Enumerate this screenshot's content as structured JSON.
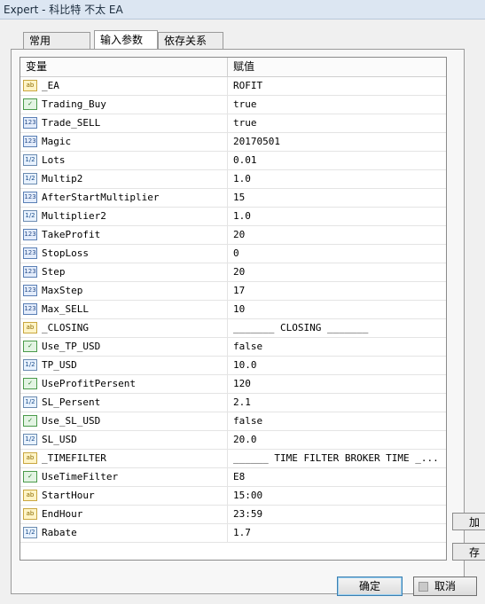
{
  "window": {
    "title": "Expert - 科比特 不太 EA"
  },
  "tabs": [
    {
      "label": "常用"
    },
    {
      "label": "输入参数"
    },
    {
      "label": "依存关系"
    }
  ],
  "grid": {
    "columns": {
      "variable": "变量",
      "value": "赋值"
    },
    "rows": [
      {
        "icon": "ab",
        "var": "_EA",
        "val": "ROFIT"
      },
      {
        "icon": "bool",
        "var": "Trading_Buy",
        "val": "true"
      },
      {
        "icon": "int",
        "var": "Trade_SELL",
        "val": "true"
      },
      {
        "icon": "int",
        "var": "Magic",
        "val": "20170501"
      },
      {
        "icon": "dbl",
        "var": "Lots",
        "val": "0.01"
      },
      {
        "icon": "dbl",
        "var": "Multip2",
        "val": "1.0"
      },
      {
        "icon": "int",
        "var": "AfterStartMultiplier",
        "val": "15"
      },
      {
        "icon": "dbl",
        "var": "Multiplier2",
        "val": "1.0"
      },
      {
        "icon": "int",
        "var": "TakeProfit",
        "val": "20"
      },
      {
        "icon": "int",
        "var": "StopLoss",
        "val": "0"
      },
      {
        "icon": "int",
        "var": "Step",
        "val": "20"
      },
      {
        "icon": "int",
        "var": "MaxStep",
        "val": "17"
      },
      {
        "icon": "int",
        "var": "Max_SELL",
        "val": "10"
      },
      {
        "icon": "ab",
        "var": "_CLOSING",
        "val": "_______ CLOSING _______"
      },
      {
        "icon": "bool",
        "var": "Use_TP_USD",
        "val": "false"
      },
      {
        "icon": "dbl",
        "var": "TP_USD",
        "val": "10.0"
      },
      {
        "icon": "bool",
        "var": "UseProfitPersent",
        "val": "120"
      },
      {
        "icon": "dbl",
        "var": "SL_Persent",
        "val": "2.1"
      },
      {
        "icon": "bool",
        "var": "Use_SL_USD",
        "val": "false"
      },
      {
        "icon": "dbl",
        "var": "SL_USD",
        "val": "20.0"
      },
      {
        "icon": "ab",
        "var": "_TIMEFILTER",
        "val": "______ TIME FILTER BROKER TIME _..."
      },
      {
        "icon": "bool",
        "var": "UseTimeFilter",
        "val": "E8"
      },
      {
        "icon": "ab",
        "var": "StartHour",
        "val": "15:00"
      },
      {
        "icon": "ab",
        "var": "EndHour",
        "val": "23:59"
      },
      {
        "icon": "dbl",
        "var": "Rabate",
        "val": "1.7"
      }
    ]
  },
  "side_buttons": [
    {
      "label": "加"
    },
    {
      "label": "存"
    }
  ],
  "footer": {
    "ok_label": "确定",
    "cancel_label": "取消"
  }
}
